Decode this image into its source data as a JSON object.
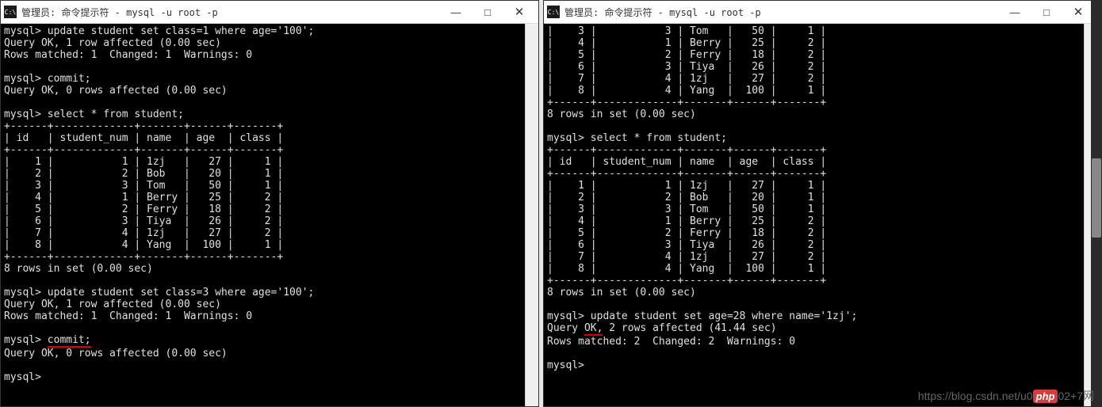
{
  "left": {
    "title": "管理员: 命令提示符 - mysql  -u root -p",
    "prompt": "mysql>",
    "cmd1": "update student set class=1 where age='100';",
    "res1a": "Query OK, 1 row affected (0.00 sec)",
    "res1b": "Rows matched: 1  Changed: 1  Warnings: 0",
    "cmd2": "commit;",
    "res2": "Query OK, 0 rows affected (0.00 sec)",
    "cmd3": "select * from student;",
    "table_border": "+------+-------------+-------+------+-------+",
    "table_header": "| id   | student_num | name  | age  | class |",
    "rows": [
      "|    1 |           1 | 1zj   |   27 |     1 |",
      "|    2 |           2 | Bob   |   20 |     1 |",
      "|    3 |           3 | Tom   |   50 |     1 |",
      "|    4 |           1 | Berry |   25 |     2 |",
      "|    5 |           2 | Ferry |   18 |     2 |",
      "|    6 |           3 | Tiya  |   26 |     2 |",
      "|    7 |           4 | 1zj   |   27 |     2 |",
      "|    8 |           4 | Yang  |  100 |     1 |"
    ],
    "rows_in_set": "8 rows in set (0.00 sec)",
    "cmd4": "update student set class=3 where age='100';",
    "res4a": "Query OK, 1 row affected (0.00 sec)",
    "res4b": "Rows matched: 1  Changed: 1  Warnings: 0",
    "cmd5_pre": "mysql> ",
    "cmd5_underlined": "commit;",
    "res5": "Query OK, 0 rows affected (0.00 sec)"
  },
  "right": {
    "title": "管理员: 命令提示符 - mysql  -u root -p",
    "prompt": "mysql>",
    "top_rows": [
      "|    3 |           3 | Tom   |   50 |     1 |",
      "|    4 |           1 | Berry |   25 |     2 |",
      "|    5 |           2 | Ferry |   18 |     2 |",
      "|    6 |           3 | Tiya  |   26 |     2 |",
      "|    7 |           4 | 1zj   |   27 |     2 |",
      "|    8 |           4 | Yang  |  100 |     1 |"
    ],
    "table_border": "+------+-------------+-------+------+-------+",
    "rows_in_set": "8 rows in set (0.00 sec)",
    "cmd1": "select * from student;",
    "table_header": "| id   | student_num | name  | age  | class |",
    "rows": [
      "|    1 |           1 | 1zj   |   27 |     1 |",
      "|    2 |           2 | Bob   |   20 |     1 |",
      "|    3 |           3 | Tom   |   50 |     1 |",
      "|    4 |           1 | Berry |   25 |     2 |",
      "|    5 |           2 | Ferry |   18 |     2 |",
      "|    6 |           3 | Tiya  |   26 |     2 |",
      "|    7 |           4 | 1zj   |   27 |     2 |",
      "|    8 |           4 | Yang  |  100 |     1 |"
    ],
    "cmd2": "update student set age=28 where name='1zj';",
    "res2a_pre": "Query ",
    "res2a_under": "OK,",
    "res2a_post": " 2 rows affected (41.44 sec)",
    "res2b": "Rows matched: 2  Changed: 2  Warnings: 0"
  },
  "watermark_pre": "https://blog.csdn.net/u0",
  "watermark_php": "php",
  "watermark_post": "02+7网",
  "chart_data": {
    "type": "table",
    "title": "student",
    "columns": [
      "id",
      "student_num",
      "name",
      "age",
      "class"
    ],
    "rows": [
      [
        1,
        1,
        "1zj",
        27,
        1
      ],
      [
        2,
        2,
        "Bob",
        20,
        1
      ],
      [
        3,
        3,
        "Tom",
        50,
        1
      ],
      [
        4,
        1,
        "Berry",
        25,
        2
      ],
      [
        5,
        2,
        "Ferry",
        18,
        2
      ],
      [
        6,
        3,
        "Tiya",
        26,
        2
      ],
      [
        7,
        4,
        "1zj",
        27,
        2
      ],
      [
        8,
        4,
        "Yang",
        100,
        1
      ]
    ]
  }
}
